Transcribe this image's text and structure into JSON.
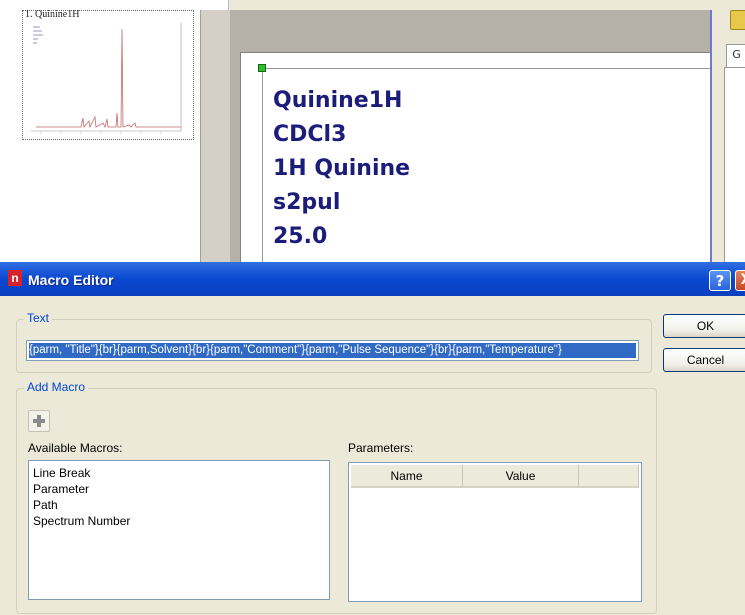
{
  "background": {
    "thumbnail_title": "1. Quinine1H",
    "right_tab_label": "G",
    "text_lines": [
      "Quinine1H",
      "CDCl3",
      "1H Quinine",
      "s2pul",
      "25.0"
    ]
  },
  "dialog": {
    "title": "Macro Editor",
    "help_label": "?",
    "close_label": "X",
    "text_group_label": "Text",
    "text_value": "{parm, \"Title\"}{br}{parm,Solvent}{br}{parm,\"Comment\"}{parm,\"Pulse Sequence\"}{br}{parm,\"Temperature\"}",
    "ok_label": "OK",
    "cancel_label": "Cancel",
    "add_macro_label": "Add Macro",
    "available_label": "Available Macros:",
    "available_items": [
      "Line Break",
      "Parameter",
      "Path",
      "Spectrum Number"
    ],
    "parameters_label": "Parameters:",
    "param_columns": [
      "Name",
      "Value"
    ]
  },
  "colors": {
    "title_bar": "#0a48d0",
    "selection": "#316ac5",
    "document_text": "#1c1c7a",
    "spectrum": "#c46a6a",
    "legend_text": "#0046d5"
  },
  "icons": [
    "folder-icon",
    "app-icon",
    "help-icon",
    "close-icon",
    "plus-icon"
  ]
}
